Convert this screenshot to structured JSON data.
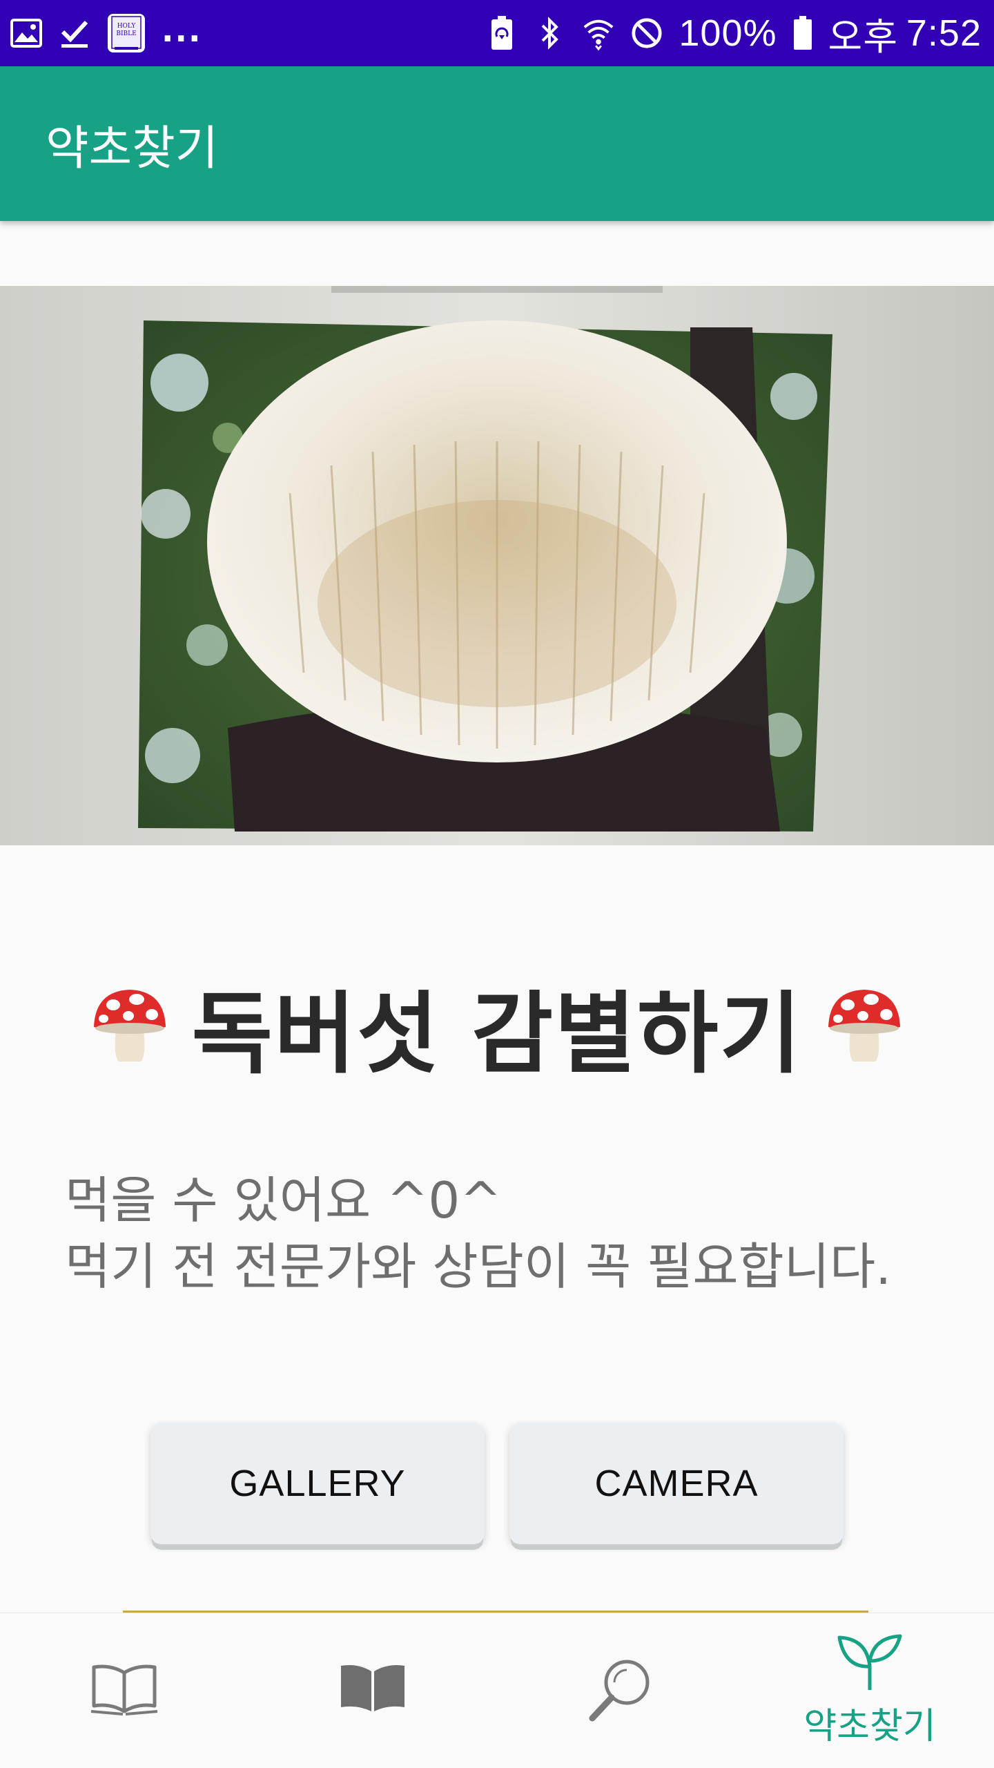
{
  "status_bar": {
    "icons_left": [
      "gallery-notification-icon",
      "check-download-icon",
      "holy-bible-app-icon"
    ],
    "bible_text_1": "HOLY",
    "bible_text_2": "BIBLE",
    "more": "...",
    "icons_right": [
      "battery-saver-icon",
      "bluetooth-icon",
      "wifi-icon",
      "do-not-disturb-icon",
      "battery-icon"
    ],
    "battery": "100%",
    "ampm": "오후",
    "time": "7:52"
  },
  "app_bar": {
    "title": "약초찾기"
  },
  "photo": {
    "description_icon": "mushroom-photo"
  },
  "heading": {
    "text": "독버섯 감별하기",
    "left_emoji": "mushroom-icon",
    "right_emoji": "mushroom-icon"
  },
  "result": {
    "line1": "먹을 수 있어요 ^0^",
    "line2": "먹기 전 전문가와 상담이 꼭 필요합니다."
  },
  "buttons": {
    "gallery": "GALLERY",
    "camera": "CAMERA"
  },
  "bottom_nav": {
    "items": [
      {
        "icon": "open-book-outline-icon",
        "label": ""
      },
      {
        "icon": "open-book-filled-icon",
        "label": ""
      },
      {
        "icon": "search-icon",
        "label": ""
      },
      {
        "icon": "sprout-icon",
        "label": "약초찾기",
        "active": true
      }
    ],
    "active_color": "#17a185"
  },
  "colors": {
    "status_bar": "#3200b4",
    "app_bar": "#17a185",
    "accent": "#17a185"
  }
}
